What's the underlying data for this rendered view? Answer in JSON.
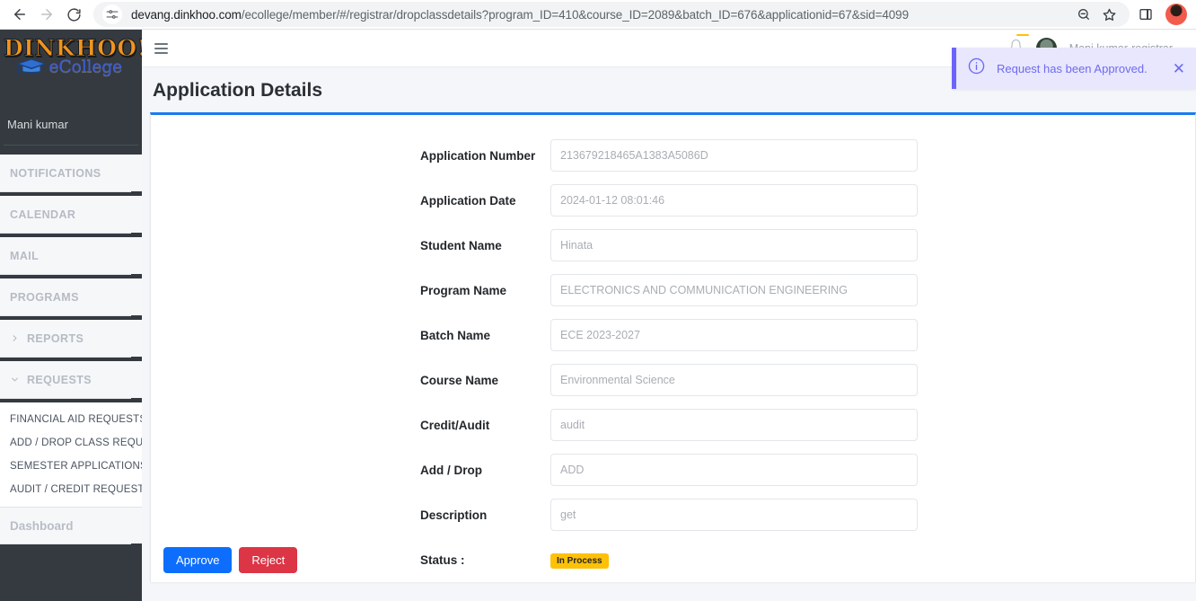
{
  "browser": {
    "back_icon": "arrow-left-icon",
    "forward_icon": "arrow-right-icon",
    "reload_icon": "reload-icon",
    "site_info_icon": "tune-icon",
    "url_prefix": "devang.dinkhoo.com",
    "url_suffix": "/ecollege/member/#/registrar/dropclassdetails?program_ID=410&course_ID=2089&batch_ID=676&applicationid=67&sid=4099",
    "zoom_out_icon": "zoom-out-icon",
    "bookmark_icon": "star-icon",
    "side_panel_icon": "side-panel-icon",
    "profile_icon": "profile-avatar"
  },
  "sidebar": {
    "logo_text": "DINKHOO!",
    "logo_sub": "eCollege",
    "cap_icon": "graduation-cap-icon",
    "user_name": "Mani kumar",
    "items": [
      {
        "label": "NOTIFICATIONS",
        "icon": null
      },
      {
        "label": "CALENDAR",
        "icon": null
      },
      {
        "label": "MAIL",
        "icon": null
      },
      {
        "label": "PROGRAMS",
        "icon": null
      },
      {
        "label": "REPORTS",
        "icon": "chevron-right-icon"
      },
      {
        "label": "REQUESTS",
        "icon": "chevron-down-icon"
      }
    ],
    "sub_items": [
      {
        "label": "FINANCIAL AID REQUESTS"
      },
      {
        "label": "ADD / DROP CLASS REQUEST"
      },
      {
        "label": "SEMESTER APPLICATIONS"
      },
      {
        "label": "AUDIT / CREDIT REQUEST"
      }
    ],
    "dashboard_label": "Dashboard"
  },
  "topbar": {
    "menu_icon": "hamburger-icon",
    "bell_icon": "bell-icon",
    "bell_badge": "",
    "user_label": "Mani kumar-registrar",
    "avatar_icon": "user-avatar"
  },
  "page": {
    "title": "Application Details"
  },
  "toast": {
    "icon": "info-circle-icon",
    "message": "Request has been Approved.",
    "close_icon": "close-icon",
    "accent_color": "#6c63ff",
    "background_color": "#e8e7fd"
  },
  "form": {
    "fields": [
      {
        "label": "Application Number",
        "value": "213679218465A1383A5086D"
      },
      {
        "label": "Application Date",
        "value": "2024-01-12 08:01:46"
      },
      {
        "label": "Student Name",
        "value": "Hinata"
      },
      {
        "label": "Program Name",
        "value": "ELECTRONICS AND COMMUNICATION ENGINEERING"
      },
      {
        "label": "Batch Name",
        "value": "ECE 2023-2027"
      },
      {
        "label": "Course Name",
        "value": "Environmental Science"
      },
      {
        "label": "Credit/Audit",
        "value": "audit"
      },
      {
        "label": "Add / Drop",
        "value": "ADD"
      },
      {
        "label": "Description",
        "value": "get"
      }
    ],
    "status_label": "Status :",
    "status_value": "In Process",
    "status_color": "#ffc107"
  },
  "actions": {
    "approve_label": "Approve",
    "reject_label": "Reject",
    "approve_color": "#0d6efd",
    "reject_color": "#dc3545"
  }
}
